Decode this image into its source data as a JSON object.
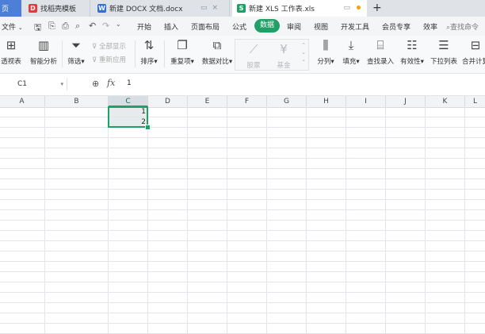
{
  "tabs": {
    "home": "页",
    "template": "找稻壳模板",
    "docx": "新建 DOCX 文档.docx",
    "xls": "新建 XLS 工作表.xls",
    "new_tab": "+"
  },
  "menu": {
    "file": "文件",
    "items": [
      "开始",
      "插入",
      "页面布局",
      "公式",
      "数据",
      "审阅",
      "视图",
      "开发工具",
      "会员专享",
      "效率"
    ],
    "active": "数据",
    "search": "查找命令"
  },
  "ribbon": {
    "pivot": "透视表",
    "smart_analysis": "智能分析",
    "filter": "筛选",
    "show_all": "全部显示",
    "reapply": "重新应用",
    "sort": "排序",
    "duplicates": "重复项",
    "compare": "数据对比",
    "stock": "股票",
    "fund": "基金",
    "split": "分列",
    "fill": "填充",
    "lookup": "查找录入",
    "validity": "有效性",
    "dropdown": "下拉列表",
    "consolidate": "合并计算"
  },
  "formula": {
    "cell_ref": "C1",
    "fx": "fx",
    "content": "1"
  },
  "columns": [
    "A",
    "B",
    "C",
    "D",
    "E",
    "F",
    "G",
    "H",
    "I",
    "J",
    "K",
    "L"
  ],
  "cells": {
    "C1": "1",
    "C2": "2"
  },
  "colors": {
    "accent": "#1fa067",
    "tab_blue": "#4d7fd6"
  }
}
